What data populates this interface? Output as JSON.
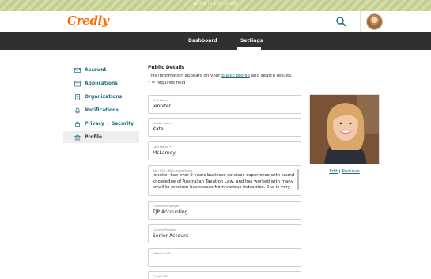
{
  "banner": {
    "text": "WEBSITE LIVE DEMO"
  },
  "header": {
    "logo": "Credly"
  },
  "nav": {
    "dashboard": "Dashboard",
    "settings": "Settings"
  },
  "sidebar": {
    "items": [
      {
        "label": "Account",
        "icon": "envelope-icon"
      },
      {
        "label": "Applications",
        "icon": "window-icon"
      },
      {
        "label": "Organizations",
        "icon": "building-icon"
      },
      {
        "label": "Notifications",
        "icon": "bell-icon"
      },
      {
        "label": "Privacy + Security",
        "icon": "lock-icon"
      },
      {
        "label": "Profile",
        "icon": "bank-icon",
        "active": true
      }
    ]
  },
  "main": {
    "title": "Public Details",
    "desc_before": "This information appears on your ",
    "desc_link": "public profile",
    "desc_after": " and search results.",
    "required_note": "* = required field",
    "fields": {
      "first_name": {
        "label": "First Name *",
        "value": "Jennifer"
      },
      "middle_name": {
        "label": "Middle Name",
        "value": "Kate"
      },
      "last_name": {
        "label": "Last Name *",
        "value": "McLarney"
      },
      "bio": {
        "label": "Bio (150 / 600 characters)",
        "value": "Jennifer has over 9 years business services experience with sound knowledge of Australian Taxation Law, and has worked with many small to medium businesses from various industries. She is very"
      },
      "employer": {
        "label": "Current Employer",
        "value": "TJP Accounting"
      },
      "position": {
        "label": "Current Position",
        "value": "Senior Account"
      },
      "website": {
        "label": "Website URL",
        "value": ""
      },
      "credly_url": {
        "label": "Credly URL",
        "value": ""
      }
    },
    "photo": {
      "edit": "Edit",
      "separator": "|",
      "remove": "Remove"
    }
  },
  "colors": {
    "brand": "#ff6b00",
    "link": "#1a6b7c",
    "navbar": "#303030"
  }
}
